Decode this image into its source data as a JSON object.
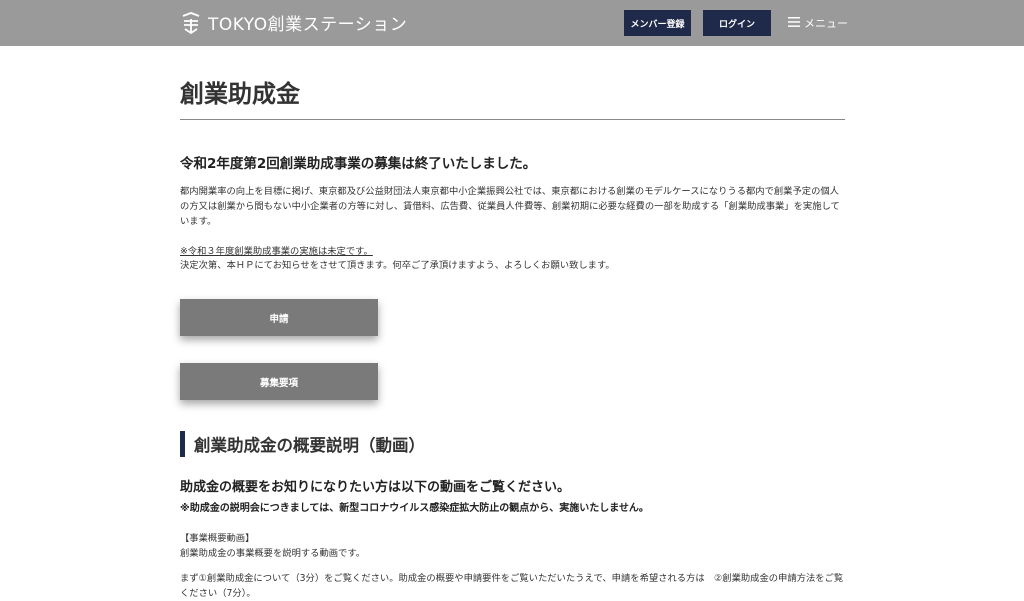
{
  "header": {
    "logo_text": "TOKYO創業ステーション",
    "register_label": "メンバー登録",
    "login_label": "ログイン",
    "menu_label": "メニュー",
    "background_color": "#9a9a9a",
    "button_color": "#1f2a4a"
  },
  "main": {
    "page_title": "創業助成金",
    "notice_title": "令和2年度第2回創業助成事業の募集は終了いたしました。",
    "intro": "都内開業率の向上を目標に掲げ、東京都及び公益財団法人東京都中小企業振興公社では、東京都における創業のモデルケースになりうる都内で創業予定の個人の方又は創業から間もない中小企業者の方等に対し、賃借料、広告費、従業員人件費等、創業初期に必要な経費の一部を助成する「創業助成事業」を実施しています。",
    "link_note": "※令和３年度創業助成事業の実施は未定です。",
    "followup": "決定次第、本ＨＰにてお知らせをさせて頂きます。何卒ご了承頂けますよう、よろしくお願い致します。",
    "apply_button": "申請",
    "guidelines_button": "募集要項"
  },
  "video_section": {
    "title": "創業助成金の概要説明（動画）",
    "lead": "助成金の概要をお知りになりたい方は以下の動画をご覧ください。",
    "warning": "※助成金の説明会につきましては、新型コロナウイルス感染症拡大防止の観点から、実施いたしません。",
    "label": "【事業概要動画】",
    "label_desc": "創業助成金の事業概要を説明する動画です。",
    "instructions": "まず①創業助成金について（3分）をご覧ください。助成金の概要や申請要件をご覧いただいたうえで、申請を希望される方は　②創業助成金の申請方法をご覧ください（7分）。"
  }
}
